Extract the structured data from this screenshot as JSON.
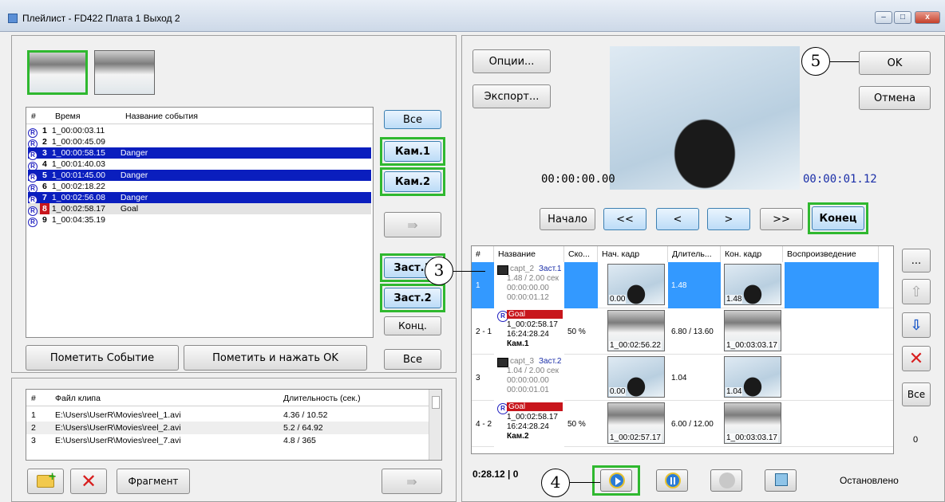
{
  "window": {
    "title": "Плейлист - FD422 Плата 1 Выход 2",
    "min": "–",
    "max": "□",
    "close": "x"
  },
  "events": {
    "columns": [
      "#",
      "Время",
      "Название события"
    ],
    "rows": [
      {
        "idx": "1",
        "time": "1_00:00:03.11",
        "name": "",
        "style": "plain"
      },
      {
        "idx": "2",
        "time": "1_00:00:45.09",
        "name": "",
        "style": "plain"
      },
      {
        "idx": "3",
        "time": "1_00:00:58.15",
        "name": "Danger",
        "style": "hl"
      },
      {
        "idx": "4",
        "time": "1_00:01:40.03",
        "name": "",
        "style": "plain"
      },
      {
        "idx": "5",
        "time": "1_00:01:45.00",
        "name": "Danger",
        "style": "hl"
      },
      {
        "idx": "6",
        "time": "1_00:02:18.22",
        "name": "",
        "style": "plain"
      },
      {
        "idx": "7",
        "time": "1_00:02:56.08",
        "name": "Danger",
        "style": "hl"
      },
      {
        "idx": "8",
        "time": "1_00:02:58.17",
        "name": "Goal",
        "style": "goal"
      },
      {
        "idx": "9",
        "time": "1_00:04:35.19",
        "name": "",
        "style": "plain"
      }
    ],
    "reg_badge": "R"
  },
  "left_buttons": {
    "all": "Все",
    "cam1": "Кам.1",
    "cam2": "Кам.2",
    "add": "⇛",
    "zast1": "Заст.1",
    "zast2": "Заст.2",
    "end": "Конц.",
    "all2": "Все"
  },
  "mark": {
    "mark_event": "Пометить Событие",
    "mark_ok": "Пометить и нажать OK"
  },
  "clips": {
    "columns": [
      "#",
      "Файл клипа",
      "Длительность (сек.)"
    ],
    "rows": [
      {
        "idx": "1",
        "file": "E:\\Users\\UserR\\Movies\\reel_1.avi",
        "dur": "4.36 / 10.52"
      },
      {
        "idx": "2",
        "file": "E:\\Users\\UserR\\Movies\\reel_2.avi",
        "dur": "5.2 / 64.92"
      },
      {
        "idx": "3",
        "file": "E:\\Users\\UserR\\Movies\\reel_7.avi",
        "dur": "4.8 / 365"
      }
    ]
  },
  "bottom_left": {
    "fragment": "Фрагмент"
  },
  "right": {
    "options": "Опции...",
    "export": "Экспорт...",
    "ok": "OK",
    "cancel": "Отмена",
    "time_start": "00:00:00.00",
    "time_end": "00:00:01.12",
    "nav": {
      "begin": "Начало",
      "rew": "<<",
      "prev": "<",
      "next": ">",
      "ff": ">>",
      "end": "Конец"
    }
  },
  "playlist": {
    "columns": [
      "#",
      "Название",
      "Ско...",
      "Нач. кадр",
      "Длитель...",
      "Кон. кадр",
      "Воспроизведение"
    ],
    "rows": [
      {
        "idx": "1",
        "line1a": "capt_2",
        "line1b": "Заст.1",
        "line2": "1.48 / 2.00 сек",
        "line3": "00:00:00.00",
        "line4": "00:00:01.12",
        "speed": "",
        "start": "0.00",
        "dur": "1.48",
        "endf": "1.48"
      },
      {
        "idx": "2 - 1",
        "line1a": "Goal",
        "line1b": "",
        "line2": "1_00:02:58.17",
        "line3": "16:24:28.24",
        "line4": "Кам.1",
        "speed": "50 %",
        "start": "1_00:02:56.22",
        "dur": "6.80 / 13.60",
        "endf": "1_00:03:03.17"
      },
      {
        "idx": "3",
        "line1a": "capt_3",
        "line1b": "Заст.2",
        "line2": "1.04 / 2.00 сек",
        "line3": "00:00:00.00",
        "line4": "00:00:01.01",
        "speed": "",
        "start": "0.00",
        "dur": "1.04",
        "endf": "1.04"
      },
      {
        "idx": "4 - 2",
        "line1a": "Goal",
        "line1b": "",
        "line2": "1_00:02:58.17",
        "line3": "16:24:28.24",
        "line4": "Кам.2",
        "speed": "50 %",
        "start": "1_00:02:57.17",
        "dur": "6.00 / 12.00",
        "endf": "1_00:03:03.17"
      }
    ]
  },
  "side_buttons": {
    "more": "...",
    "all": "Все",
    "count": "0"
  },
  "status": {
    "duration": "0:28.12 | 0",
    "state": "Остановлено"
  },
  "callouts": {
    "c3": "3",
    "c4": "4",
    "c5": "5"
  }
}
